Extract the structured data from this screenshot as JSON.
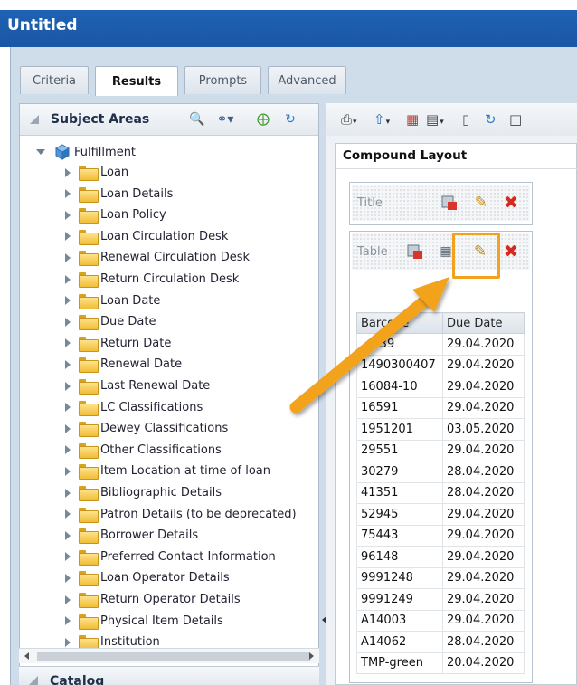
{
  "window": {
    "title": "Untitled"
  },
  "tabs": [
    {
      "label": "Criteria",
      "active": false
    },
    {
      "label": "Results",
      "active": true
    },
    {
      "label": "Prompts",
      "active": false
    },
    {
      "label": "Advanced",
      "active": false
    }
  ],
  "subject_areas": {
    "title": "Subject Areas",
    "root": "Fulfillment",
    "items": [
      "Loan",
      "Loan Details",
      "Loan Policy",
      "Loan Circulation Desk",
      "Renewal Circulation Desk",
      "Return Circulation Desk",
      "Loan Date",
      "Due Date",
      "Return Date",
      "Renewal Date",
      "Last Renewal Date",
      "LC Classifications",
      "Dewey Classifications",
      "Other Classifications",
      "Item Location at time of loan",
      "Bibliographic Details",
      "Patron Details (to be deprecated)",
      "Borrower Details",
      "Preferred Contact Information",
      "Loan Operator Details",
      "Return Operator Details",
      "Physical Item Details",
      "Institution"
    ]
  },
  "catalog": {
    "title": "Catalog"
  },
  "compound_layout": {
    "title": "Compound Layout",
    "views": [
      {
        "label": "Title"
      },
      {
        "label": "Table"
      }
    ]
  },
  "results_table": {
    "headers": [
      "Barcode",
      "Due Date"
    ],
    "rows": [
      [
        "...039",
        "29.04.2020"
      ],
      [
        "1490300407",
        "29.04.2020"
      ],
      [
        "16084-10",
        "29.04.2020"
      ],
      [
        "16591",
        "29.04.2020"
      ],
      [
        "1951201",
        "03.05.2020"
      ],
      [
        "29551",
        "29.04.2020"
      ],
      [
        "30279",
        "28.04.2020"
      ],
      [
        "41351",
        "28.04.2020"
      ],
      [
        "52945",
        "29.04.2020"
      ],
      [
        "75443",
        "29.04.2020"
      ],
      [
        "96148",
        "29.04.2020"
      ],
      [
        "9991248",
        "29.04.2020"
      ],
      [
        "9991249",
        "29.04.2020"
      ],
      [
        "A14003",
        "29.04.2020"
      ],
      [
        "A14062",
        "28.04.2020"
      ],
      [
        "TMP-green",
        "20.04.2020"
      ]
    ]
  },
  "colors": {
    "title_bar": "#1a57a5",
    "frame": "#cfdcea",
    "highlight": "#f3a21f",
    "delete_icon": "#d52b1e",
    "edit_icon": "#c58b13",
    "folder": "#f0bd36"
  },
  "icons": [
    "search-icon",
    "binoculars-icon",
    "add-icon",
    "refresh-icon",
    "print-icon",
    "export-icon",
    "edit-icon",
    "delete-icon"
  ]
}
